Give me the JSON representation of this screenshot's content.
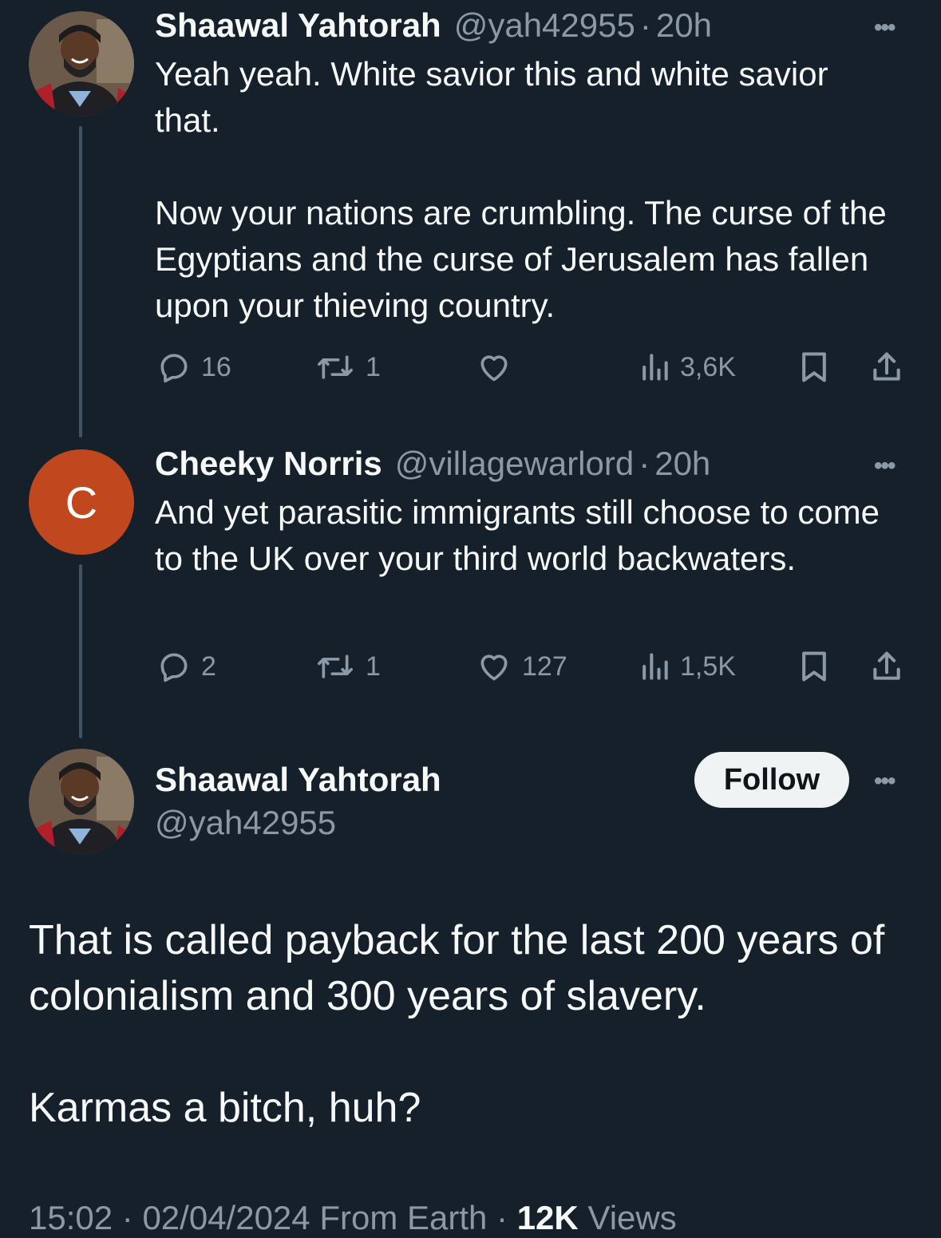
{
  "tweets": [
    {
      "name": "Shaawal Yahtorah",
      "handle": "@yah42955",
      "time": "20h",
      "text": "Yeah yeah. White savior this and white savior that.\n\nNow your nations are crumbling. The curse of the Egyptians and the curse of Jerusalem has fallen upon your thieving country.",
      "replies": "16",
      "retweets": "1",
      "likes": "",
      "views": "3,6K"
    },
    {
      "name": "Cheeky Norris",
      "handle": "@villagewarlord",
      "time": "20h",
      "avatar_letter": "C",
      "avatar_color": "#c1481e",
      "text": "And yet parasitic immigrants still choose to come to the UK over your third world backwaters.",
      "replies": "2",
      "retweets": "1",
      "likes": "127",
      "views": "1,5K"
    }
  ],
  "main": {
    "name": "Shaawal Yahtorah",
    "handle": "@yah42955",
    "follow_label": "Follow",
    "text": "That is called payback for the last 200 years of colonialism and 300 years of slavery.\n\nKarmas a bitch, huh?",
    "time": "15:02",
    "date": "02/04/2024",
    "source": "From Earth",
    "views_count": "12K",
    "views_label": "Views"
  },
  "colors": {
    "background": "#15202b",
    "text": "#f7f9f9",
    "secondary": "#8b98a5",
    "thread_line": "#425364"
  }
}
